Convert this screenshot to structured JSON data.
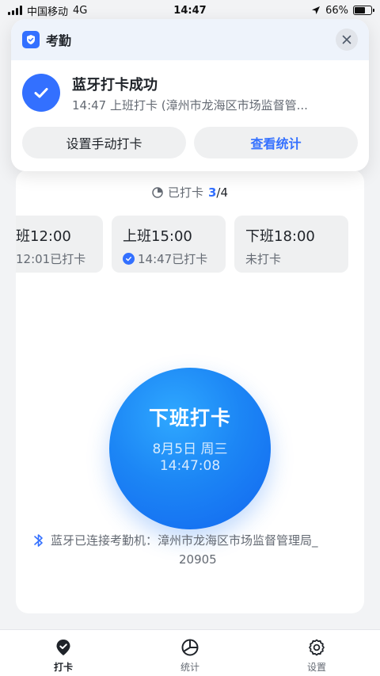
{
  "status_bar": {
    "carrier": "中国移动",
    "network": "4G",
    "time": "14:47",
    "battery": "66%",
    "battery_level": 0.66,
    "icons": [
      "signal-icon",
      "location-arrow-icon",
      "battery-icon"
    ]
  },
  "notification": {
    "app_name": "考勤",
    "title": "蓝牙打卡成功",
    "subtitle": "14:47 上班打卡 (漳州市龙海区市场监督管...",
    "secondary_action": "设置手动打卡",
    "primary_action": "查看统计",
    "icons": [
      "app-shield-icon",
      "close-icon",
      "success-check-icon"
    ]
  },
  "progress": {
    "label": "已打卡",
    "done": "3",
    "total": "/4"
  },
  "shifts": [
    {
      "title": "班12:00",
      "status": "12:01已打卡"
    },
    {
      "title": "上班15:00",
      "status": "14:47已打卡"
    },
    {
      "title": "下班18:00",
      "status": "未打卡"
    }
  ],
  "clock_button": {
    "label": "下班打卡",
    "date": "8月5日 周三",
    "time": "14:47:08"
  },
  "bluetooth": {
    "line1": "蓝牙已连接考勤机：漳州市龙海区市场监督管理局_",
    "line2": "20905",
    "icon": "bluetooth-icon"
  },
  "tabs": [
    {
      "label": "打卡",
      "icon": "checkin-pin-icon",
      "active": true
    },
    {
      "label": "统计",
      "icon": "stats-pie-icon",
      "active": false
    },
    {
      "label": "设置",
      "icon": "gear-icon",
      "active": false
    }
  ],
  "colors": {
    "accent": "#3370ff",
    "button_gradient_top": "#2fa8ff",
    "button_gradient_bottom": "#1266f0"
  }
}
